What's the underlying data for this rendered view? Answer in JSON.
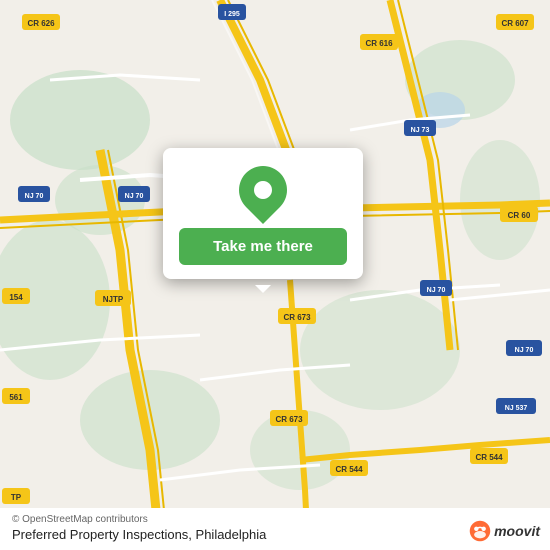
{
  "map": {
    "attribution": "© OpenStreetMap contributors",
    "background_color": "#f2efe9"
  },
  "popup": {
    "button_label": "Take me there",
    "icon_color": "#4caf50"
  },
  "bottom_bar": {
    "location_name": "Preferred Property Inspections, Philadelphia",
    "attribution_text": "© OpenStreetMap contributors"
  },
  "moovit": {
    "logo_text": "moovit"
  },
  "roads": {
    "accent_color": "#fdd835",
    "highway_color": "#f5c518",
    "local_road_color": "#ffffff",
    "green_area_color": "#c8dfc8"
  }
}
